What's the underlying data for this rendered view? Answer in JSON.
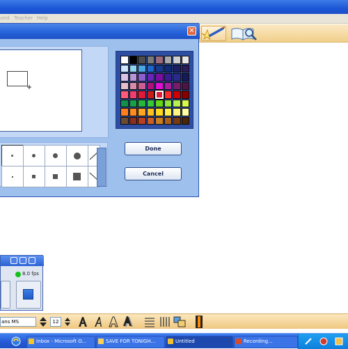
{
  "menu": {
    "items": [
      "und",
      "Teacher",
      "Help"
    ]
  },
  "dialog": {
    "close_icon": "close-icon",
    "done_label": "Done",
    "cancel_label": "Cancel",
    "palette": [
      "#ffffff",
      "#000000",
      "#4d4d4d",
      "#7a7a7a",
      "#996b7c",
      "#a8a8a8",
      "#cfcfcf",
      "#e6e6e6",
      "#cfe6ff",
      "#8fd3f0",
      "#4aa6e3",
      "#1c69c9",
      "#193a93",
      "#0f2a78",
      "#1c1f64",
      "#2e1d5d",
      "#d9c2e6",
      "#b895d6",
      "#8c5fcf",
      "#6a24b8",
      "#7c0ea3",
      "#3a1d92",
      "#2a2a8d",
      "#151a58",
      "#e5bfca",
      "#d88ca8",
      "#cc5e93",
      "#b30f78",
      "#e00fd3",
      "#aa1d9c",
      "#7a1b6a",
      "#4c1546",
      "#ff5a7a",
      "#f03f6e",
      "#e01b3a",
      "#cc1a1a",
      "#e21b3a",
      "#ff2a2a",
      "#cc0000",
      "#8a0000",
      "#13904a",
      "#19a04d",
      "#25b83d",
      "#37cc33",
      "#63d818",
      "#8fe33b",
      "#b9f051",
      "#d8fb4f",
      "#ff7f1f",
      "#ff8c1f",
      "#ffa51f",
      "#ffbf1f",
      "#ffd91f",
      "#fff04a",
      "#fff780",
      "#ffffa6",
      "#6b4a2f",
      "#8a2f1f",
      "#b83f1f",
      "#cc5f1f",
      "#cc7f1f",
      "#aa6019",
      "#7a3a10",
      "#4a2608"
    ],
    "selected_swatch": 36
  },
  "recorder": {
    "fps_label": "8.0 fps"
  },
  "text_toolbar": {
    "font_value": "ans MS",
    "size_value": "12"
  },
  "taskbar": {
    "items": [
      {
        "label": "",
        "icon_color": "#e1b12f"
      },
      {
        "label": "Inbox - Microsoft O...",
        "icon_color": "#f5c52a"
      },
      {
        "label": "SAVE FOR TONIGH...",
        "icon_color": "#f7d256"
      },
      {
        "label": "Untitled",
        "icon_color": "#f0c030"
      },
      {
        "label": "Recording...",
        "icon_color": "#d84b2a"
      }
    ]
  },
  "colors": {
    "accent": "#2460d8",
    "taskbar": "#2659d6",
    "toolbar": "#efc880"
  }
}
